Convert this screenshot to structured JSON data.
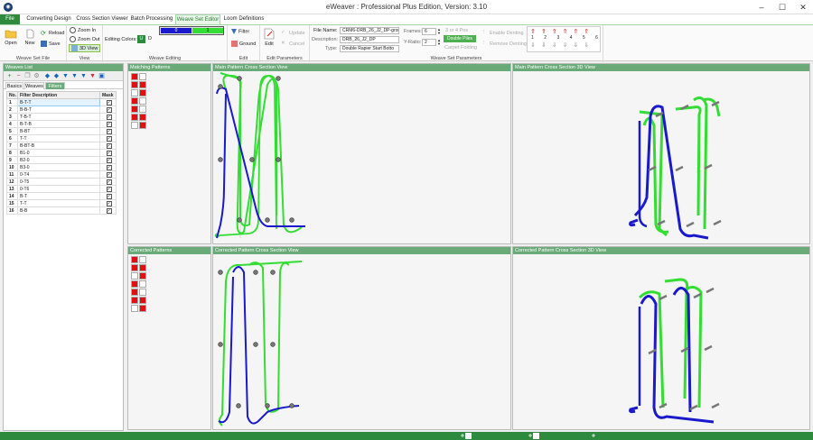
{
  "window": {
    "title": "eWeaver : Professional Plus Edition, Version: 3.10",
    "logo": "logo-icon"
  },
  "tabs": [
    "File",
    "Converting Design",
    "Cross Section Viewer",
    "Batch Processing",
    "Weave Set Editor",
    "Loom Definitions"
  ],
  "ribbon": {
    "weave_set_file": {
      "label": "Weave Set File",
      "open": "Open",
      "new": "New",
      "reload": "Reload",
      "save": "Save"
    },
    "view": {
      "label": "View",
      "zoom_in": "Zoom In",
      "zoom_out": "Zoom Out",
      "view_3d": "3D View"
    },
    "weave_editing": {
      "label": "Weave Editing",
      "editing_colors": "Editing Colors:",
      "color_u": "U",
      "color_d": "D",
      "bar_left": "0",
      "bar_right": "1"
    },
    "edit": {
      "label": "Edit",
      "filter": "Filter",
      "ground": "Ground"
    },
    "edit_parameters": {
      "label": "Edit Parameters",
      "edit": "Edit",
      "update": "Update",
      "cancel": "Cancel"
    },
    "weave_set_parameters": {
      "label": "Weave Set Parameters",
      "file_name_label": "File Name:",
      "file_name": "CRM6-DRB_26_J2_DP-grour",
      "description_label": "Description:",
      "description": "DRB_26_J2_DP",
      "type_label": "Type:",
      "type": "Double Rapier Start Botto",
      "frames_label": "Frames:",
      "frames": "6",
      "y_ratio_label": "Y-Ratio:",
      "y_ratio": "2",
      "three_or_four_pos": "3 or 4 Pos",
      "double_piles": "Double Piles",
      "carpet_folding": "Carpet Folding",
      "enable_denting": "Enable Denting",
      "remove_denting": "Remove Denting",
      "frame_numbers": [
        "1",
        "2",
        "3",
        "4",
        "5",
        "6"
      ]
    }
  },
  "weaves_list": {
    "title": "Weaves List",
    "subtabs": [
      "Basics",
      "Weaves",
      "Filters"
    ],
    "columns": [
      "No.",
      "Filter Description",
      "Mask"
    ],
    "rows": [
      [
        "1",
        "B-T-T"
      ],
      [
        "2",
        "B-B-T"
      ],
      [
        "3",
        "T-B-T"
      ],
      [
        "4",
        "B-T-B"
      ],
      [
        "5",
        "B-BT"
      ],
      [
        "6",
        "T-T"
      ],
      [
        "7",
        "B-BT-B"
      ],
      [
        "8",
        "B1-0"
      ],
      [
        "9",
        "B2-0"
      ],
      [
        "10",
        "B3-0"
      ],
      [
        "11",
        "0-T4"
      ],
      [
        "12",
        "0-T5"
      ],
      [
        "13",
        "0-T6"
      ],
      [
        "14",
        "B-T"
      ],
      [
        "15",
        "T-T"
      ],
      [
        "16",
        "B-B"
      ]
    ]
  },
  "panes": {
    "matching": "Matching Patterns",
    "main_cross": "Main Pattern Cross Section View",
    "main_3d": "Main Pattern Cross Section 3D View",
    "corrected": "Corrected Patterns",
    "corrected_cross": "Corrected Pattern Cross Section View",
    "corrected_3d": "Corrected Pattern Cross Section 3D View"
  },
  "colors": {
    "accent": "#2e8b3e",
    "header": "#6aaa78",
    "blue_yarn": "#1a1acc",
    "green_yarn": "#33dd33",
    "red_cell": "#e01010"
  },
  "matching_grid": [
    "r",
    "w",
    "r",
    "r",
    "w",
    "r",
    "r",
    "w",
    "r",
    "w",
    "r",
    "r",
    "w",
    "r"
  ],
  "corrected_grid": [
    "r",
    "w",
    "r",
    "r",
    "w",
    "r",
    "r",
    "w",
    "r",
    "w",
    "r",
    "r",
    "w",
    "r"
  ]
}
